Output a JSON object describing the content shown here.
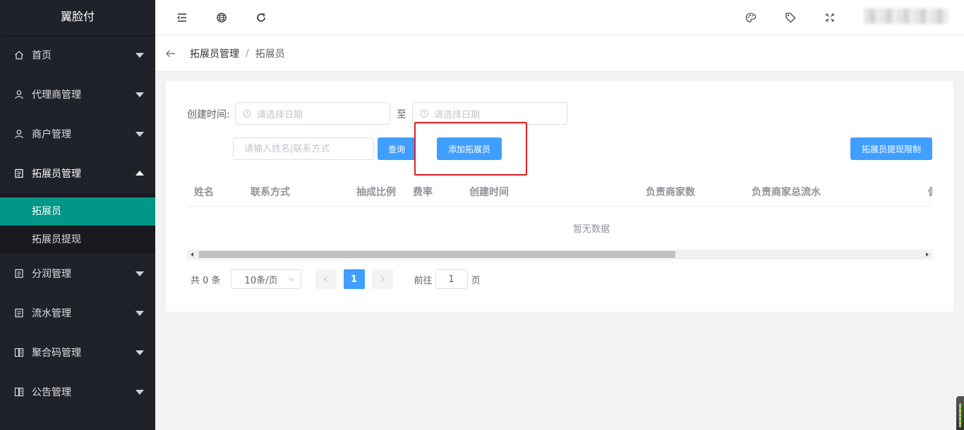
{
  "sidebar": {
    "logo": "翼脸付",
    "items": [
      {
        "label": "首页",
        "icon": "home-icon"
      },
      {
        "label": "代理商管理",
        "icon": "user-icon"
      },
      {
        "label": "商户管理",
        "icon": "user-icon"
      },
      {
        "label": "拓展员管理",
        "icon": "document-icon",
        "open": true,
        "children": [
          {
            "label": "拓展员",
            "active": true
          },
          {
            "label": "拓展员提现"
          }
        ]
      },
      {
        "label": "分润管理",
        "icon": "document-icon"
      },
      {
        "label": "流水管理",
        "icon": "document-icon"
      },
      {
        "label": "聚合码管理",
        "icon": "grid-document-icon"
      },
      {
        "label": "公告管理",
        "icon": "grid-document-icon"
      }
    ]
  },
  "header": {
    "icons": [
      "menu-fold-icon",
      "globe-icon",
      "refresh-icon",
      "palette-icon",
      "tag-icon",
      "fullscreen-icon"
    ]
  },
  "breadcrumb": {
    "items": [
      "拓展员管理",
      "拓展员"
    ]
  },
  "filters": {
    "created_label": "创建时间:",
    "start_placeholder": "请选择日期",
    "to_label": "至",
    "end_placeholder": "请选择日期",
    "search_placeholder": "请输入姓名|联系方式",
    "query_button": "查询",
    "add_button": "添加拓展员",
    "limit_button": "拓展员提现限制"
  },
  "table": {
    "columns": [
      "姓名",
      "联系方式",
      "抽成比例",
      "费率",
      "创建时间",
      "负责商家数",
      "负责商家总流水",
      "佣"
    ],
    "empty_text": "暂无数据"
  },
  "pagination": {
    "total": "共 0 条",
    "page_size": "10条/页",
    "current_page": "1",
    "goto_label": "前往",
    "goto_value": "1",
    "page_suffix": "页"
  },
  "colors": {
    "sidebar_bg": "#20222a",
    "active_item": "#009688",
    "primary": "#409eff",
    "highlight": "#e02020"
  }
}
